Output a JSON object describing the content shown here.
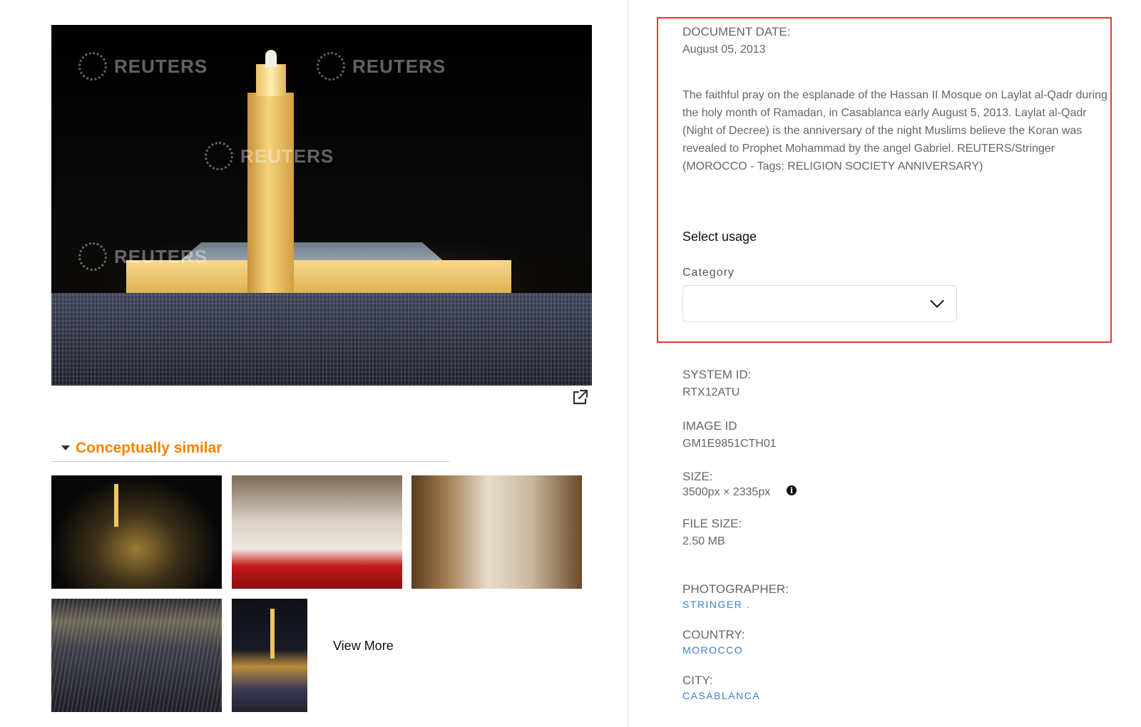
{
  "main_image": {
    "watermark_text": "REUTERS"
  },
  "similar": {
    "section_title": "Conceptually similar",
    "view_more_label": "View More"
  },
  "details": {
    "document_date_label": "DOCUMENT DATE:",
    "document_date_value": "August 05, 2013",
    "caption": "The faithful pray on the esplanade of the Hassan II Mosque on Laylat al-Qadr during the holy month of Ramadan, in Casablanca early August 5, 2013. Laylat al-Qadr (Night of Decree) is the anniversary of the night Muslims believe the Koran was revealed to Prophet Mohammad by the angel Gabriel. REUTERS/Stringer (MOROCCO - Tags: RELIGION SOCIETY ANNIVERSARY)",
    "select_usage_label": "Select usage",
    "category_label": "Category",
    "category_value": "",
    "system_id_label": "SYSTEM ID:",
    "system_id_value": "RTX12ATU",
    "image_id_label": "IMAGE ID",
    "image_id_value": "GM1E9851CTH01",
    "size_label": "SIZE:",
    "size_value": "3500px × 2335px",
    "file_size_label": "FILE SIZE:",
    "file_size_value": "2.50 MB",
    "photographer_label": "PHOTOGRAPHER:",
    "photographer_value": "STRINGER .",
    "country_label": "COUNTRY:",
    "country_value": "MOROCCO",
    "city_label": "CITY:",
    "city_value": "CASABLANCA"
  },
  "colors": {
    "accent_orange": "#ff8000",
    "link_blue": "#3b82c4",
    "highlight_red": "#e53935"
  },
  "icons": [
    "external-link-icon",
    "caret-down-icon",
    "chevron-down-icon",
    "info-icon"
  ]
}
